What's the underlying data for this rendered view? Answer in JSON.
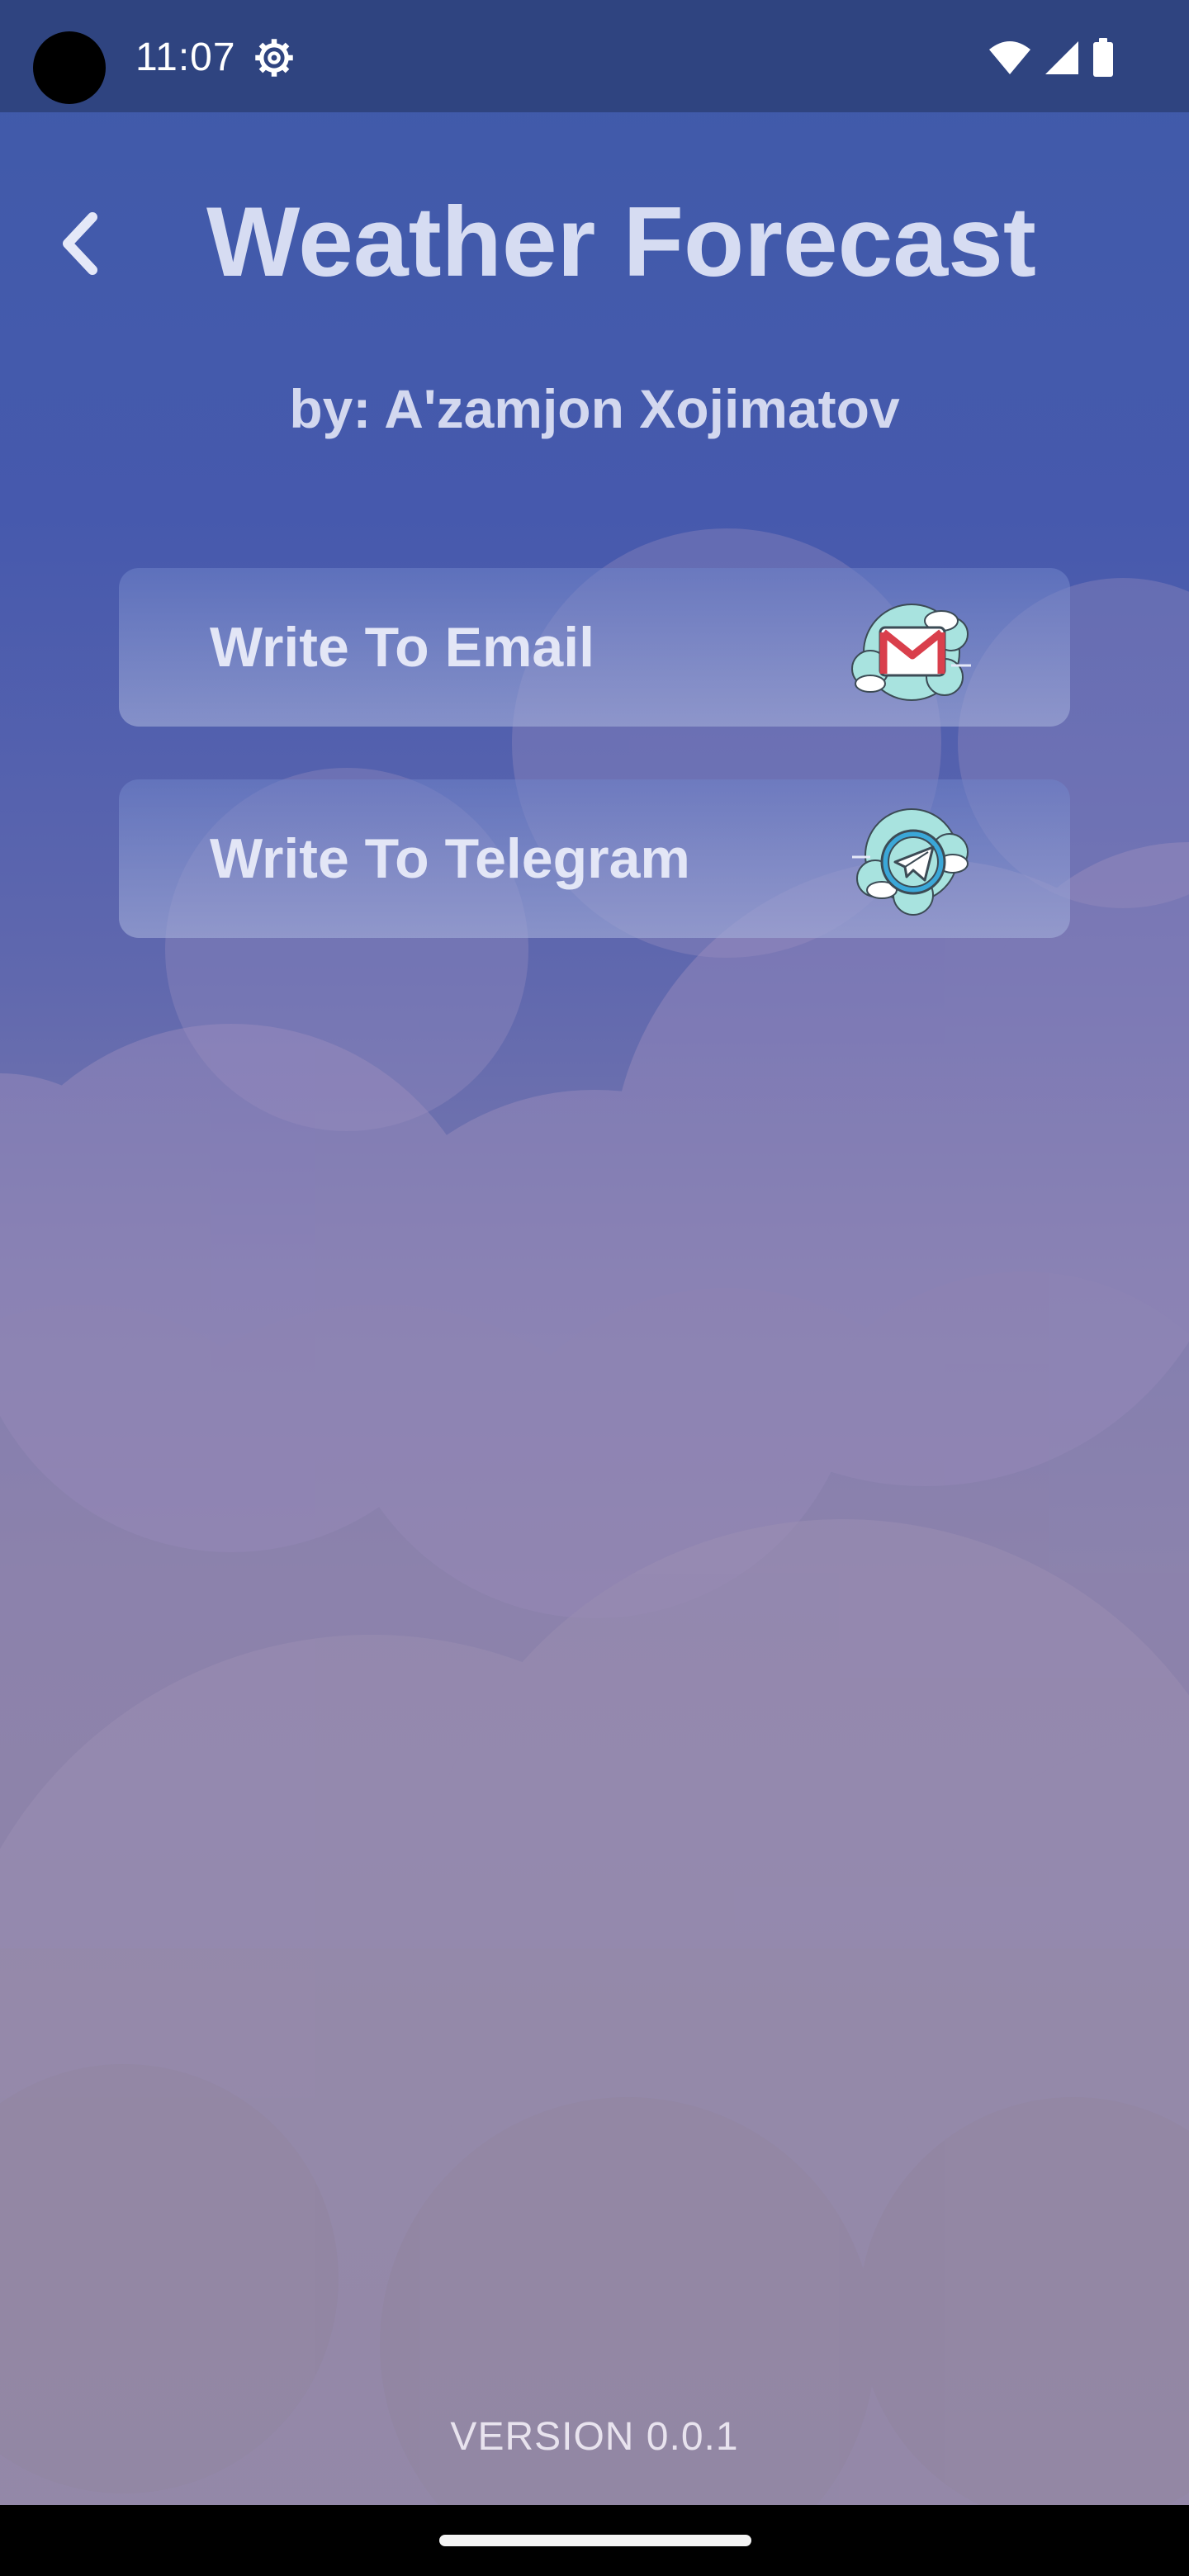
{
  "status_bar": {
    "time": "11:07",
    "icons": [
      "settings-gear-icon",
      "wifi-icon",
      "signal-icon",
      "battery-icon"
    ]
  },
  "header": {
    "back_icon": "chevron-left-icon",
    "title": "Weather Forecast",
    "author": "by: A'zamjon Xojimatov"
  },
  "contacts": [
    {
      "label": "Write To Email",
      "icon": "gmail-cloud-icon"
    },
    {
      "label": "Write To Telegram",
      "icon": "telegram-cloud-icon"
    }
  ],
  "footer": {
    "version": "VERSION 0.0.1"
  },
  "colors": {
    "status_bar": "#2f4480",
    "background_top": "#3f5ba9",
    "background_bottom": "#8c819b",
    "title_text": "#d6dcf2",
    "gmail_red": "#d93f4c",
    "telegram_blue": "#3aa7d8",
    "icon_cloud": "#a8e3df"
  }
}
